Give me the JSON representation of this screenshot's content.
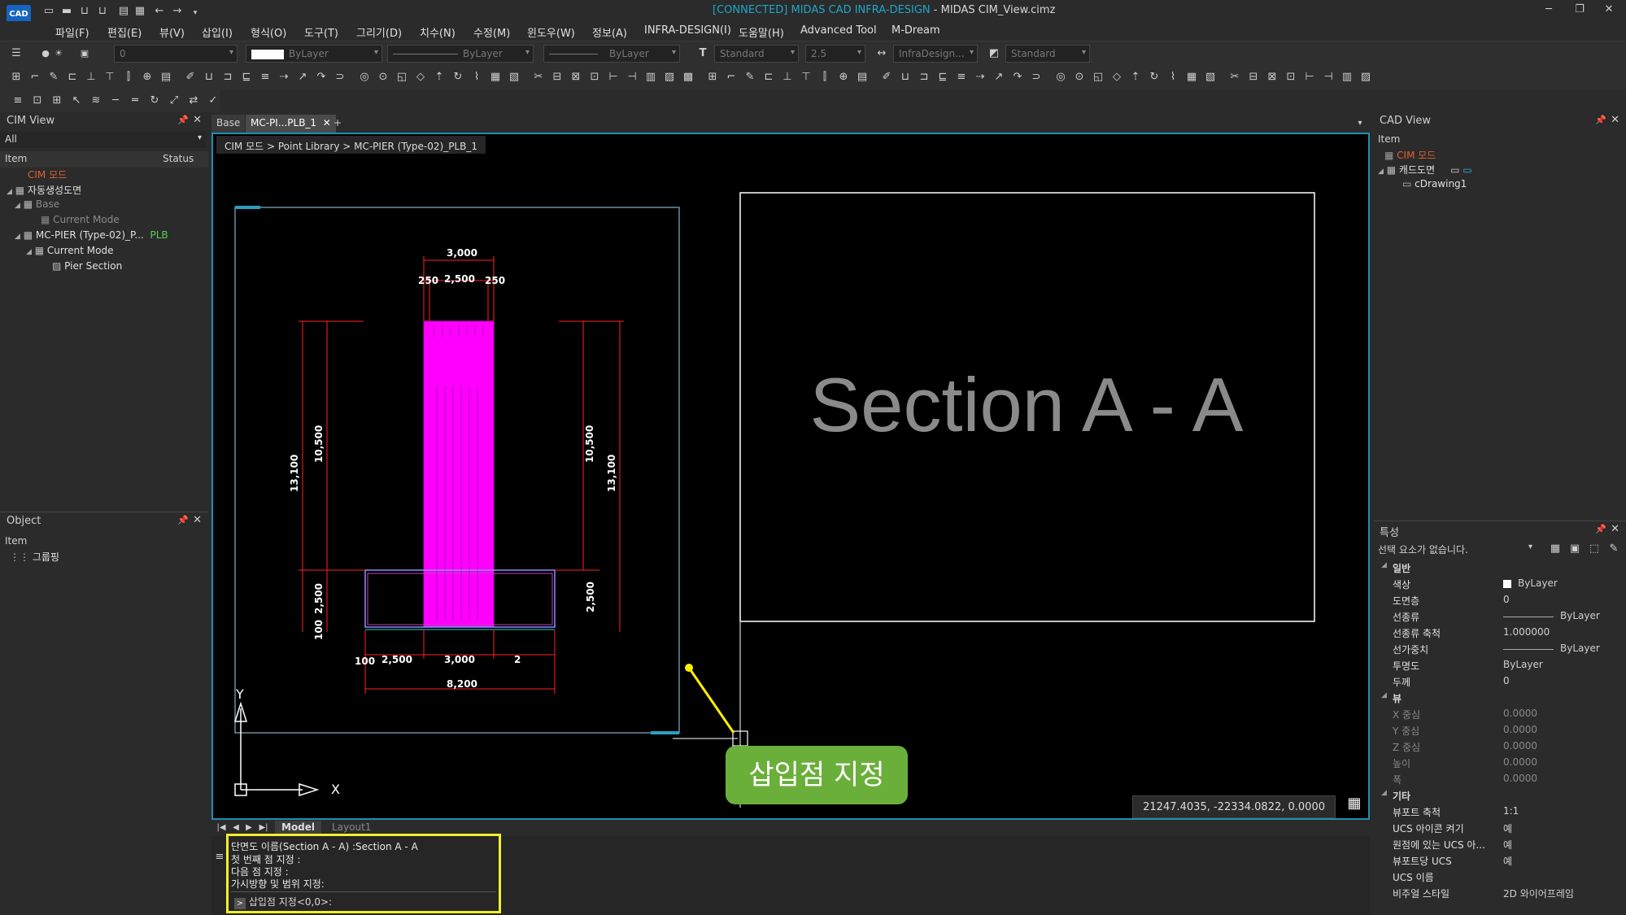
{
  "window": {
    "title_status": "[CONNECTED] MIDAS CAD INFRA-DESIGN",
    "title_file": " - MIDAS CIM_View.cimz",
    "logo_text": "CAD",
    "accent": "#1e8fb0"
  },
  "menu": [
    "파일(F)",
    "편집(E)",
    "뷰(V)",
    "삽입(I)",
    "형식(O)",
    "도구(T)",
    "그리기(D)",
    "치수(N)",
    "수정(M)",
    "윈도우(W)",
    "정보(A)",
    "INFRA-DESIGN(I)",
    "도움말(H)",
    "Advanced Tool",
    "M-Dream"
  ],
  "toolbar": {
    "layer_value": "0",
    "color_value": "ByLayer",
    "linetype_value": "ByLayer",
    "lineweight_value": "ByLayer",
    "text_style": "Standard",
    "text_height": "2.5",
    "dim_style": "InfraDesign...",
    "table_style": "Standard"
  },
  "cim_view": {
    "title": "CIM View",
    "filter": "All",
    "col_item": "Item",
    "col_status": "Status",
    "tree": [
      {
        "label": "CIM 모드",
        "style": "orange"
      },
      {
        "label": "자동생성도면",
        "style": "normal"
      },
      {
        "label": "Base",
        "style": "dim"
      },
      {
        "label": "Current Mode",
        "style": "dim"
      },
      {
        "label": "MC-PIER (Type-02)_P...",
        "style": "normal",
        "status": "PLB"
      },
      {
        "label": "Current Mode",
        "style": "normal"
      },
      {
        "label": "Pier Section",
        "style": "normal"
      }
    ]
  },
  "object_panel": {
    "title": "Object",
    "col_item": "Item",
    "item": "그룹핑"
  },
  "tabs": [
    "Base",
    "MC-PI...PLB_1"
  ],
  "breadcrumb": "CIM 모드 > Point Library > MC-PIER (Type-02)_PLB_1",
  "drawing": {
    "dims_top": [
      "3,000",
      "250",
      "2,500",
      "250"
    ],
    "dims_left": [
      "13,100",
      "10,500",
      "2,500",
      "100"
    ],
    "dims_right": [
      "10,500",
      "13,100",
      "2,500"
    ],
    "dims_bottom": [
      "100",
      "2,500",
      "3,000",
      "2",
      "8,200"
    ],
    "section_title": "Section A - A",
    "axis_y": "Y",
    "axis_x": "X"
  },
  "callout": "삽입점 지정",
  "coords": "21247.4035, -22334.0822, 0.0000",
  "layout_tabs": [
    "Model",
    "Layout1"
  ],
  "command": {
    "lines": [
      "단면도 이름(Section A - A) :Section A - A",
      "첫 번째 점 지정 :",
      "다음 점 지정 :",
      "가시방향 및 범위 지정:"
    ],
    "prompt": "삽입점 지정<0,0>:"
  },
  "cad_view": {
    "title": "CAD View",
    "col_item": "Item",
    "tree": [
      "CIM 모드",
      "캐드도면",
      "cDrawing1"
    ]
  },
  "properties": {
    "title": "특성",
    "selection": "선택 요소가 없습니다.",
    "sections": {
      "general": "일반",
      "view": "뷰",
      "misc": "기타"
    },
    "general": [
      {
        "k": "색상",
        "v": "ByLayer"
      },
      {
        "k": "도면층",
        "v": "0"
      },
      {
        "k": "선종류",
        "v": "ByLayer"
      },
      {
        "k": "선종류 축척",
        "v": "1.000000"
      },
      {
        "k": "선가중치",
        "v": "ByLayer"
      },
      {
        "k": "투명도",
        "v": "ByLayer"
      },
      {
        "k": "두께",
        "v": "0"
      }
    ],
    "view": [
      {
        "k": "X 중심",
        "v": "0.0000"
      },
      {
        "k": "Y 중심",
        "v": "0.0000"
      },
      {
        "k": "Z 중심",
        "v": "0.0000"
      },
      {
        "k": "높이",
        "v": "0.0000"
      },
      {
        "k": "폭",
        "v": "0.0000"
      }
    ],
    "misc": [
      {
        "k": "뷰포트 축척",
        "v": "1:1"
      },
      {
        "k": "UCS 아이콘 켜기",
        "v": "예"
      },
      {
        "k": "원점에 있는 UCS 아...",
        "v": "예"
      },
      {
        "k": "뷰포트당 UCS",
        "v": "예"
      },
      {
        "k": "UCS 이름",
        "v": ""
      },
      {
        "k": "비주얼 스타일",
        "v": "2D 와이어프레임"
      }
    ]
  }
}
